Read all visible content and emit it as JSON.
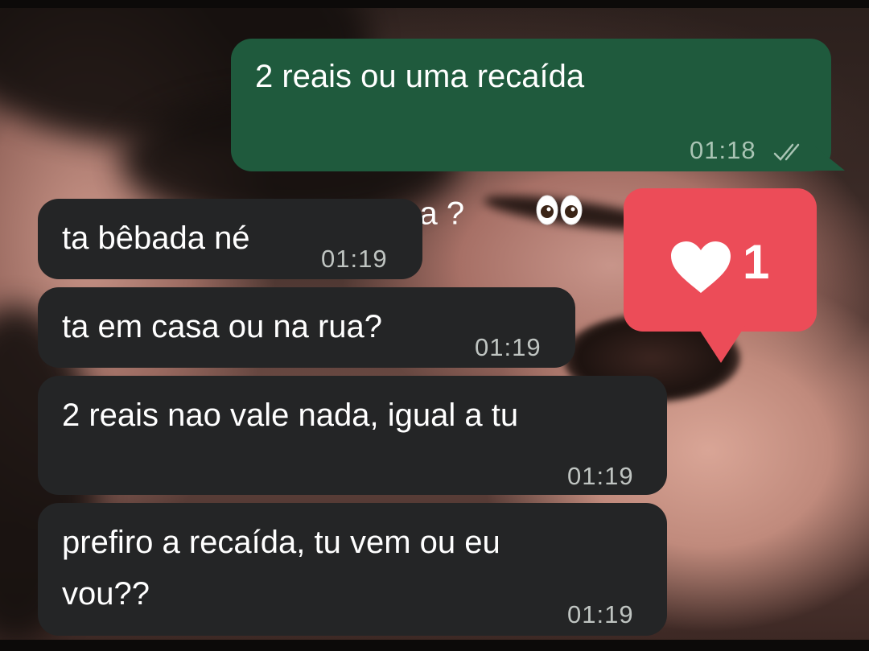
{
  "messages": [
    {
      "id": "m1",
      "direction": "outgoing",
      "lines": [
        "2 reais ou uma recaída",
        "misteriosa ? "
      ],
      "emoji": "eyes",
      "time": "01:18",
      "status": "read"
    },
    {
      "id": "m2",
      "direction": "incoming",
      "lines": [
        "ta bêbada né"
      ],
      "time": "01:19"
    },
    {
      "id": "m3",
      "direction": "incoming",
      "lines": [
        "ta em casa ou na rua?"
      ],
      "time": "01:19"
    },
    {
      "id": "m4",
      "direction": "incoming",
      "lines": [
        "2 reais nao vale nada, igual a tu"
      ],
      "time": "01:19"
    },
    {
      "id": "m5",
      "direction": "incoming",
      "lines": [
        "prefiro a recaída, tu vem ou eu",
        "vou??"
      ],
      "time": "01:19"
    }
  ],
  "like_notification": {
    "icon": "heart-icon",
    "count": "1",
    "color": "#ec4c58"
  },
  "colors": {
    "outgoing_bubble": "#1f5a3d",
    "incoming_bubble": "#242526"
  }
}
